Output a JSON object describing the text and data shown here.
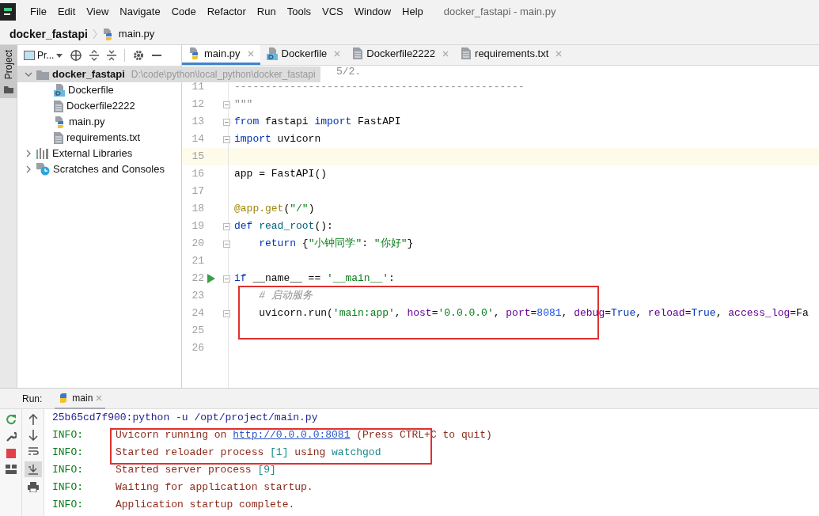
{
  "menu": [
    "File",
    "Edit",
    "View",
    "Navigate",
    "Code",
    "Refactor",
    "Run",
    "Tools",
    "VCS",
    "Window",
    "Help"
  ],
  "window_title": "docker_fastapi - main.py",
  "breadcrumb": [
    "docker_fastapi",
    "main.py"
  ],
  "tool_strip": {
    "label": "Project"
  },
  "project_panel": {
    "view_label": "Pr...",
    "tree": [
      {
        "label": "docker_fastapi",
        "path": "D:\\code\\python\\local_python\\docker_fastapi",
        "kind": "folder",
        "selected": true,
        "expanded": true,
        "children": [
          {
            "label": "Dockerfile",
            "kind": "docker",
            "selected": false
          },
          {
            "label": "Dockerfile2222",
            "kind": "text",
            "selected": false
          },
          {
            "label": "main.py",
            "kind": "python",
            "selected": false
          },
          {
            "label": "requirements.txt",
            "kind": "text",
            "selected": false
          }
        ]
      },
      {
        "label": "External Libraries",
        "kind": "library",
        "selected": false,
        "expanded": false
      },
      {
        "label": "Scratches and Consoles",
        "kind": "scratch",
        "selected": false,
        "expanded": false
      }
    ]
  },
  "editor_tabs": [
    {
      "label": "main.py",
      "kind": "python",
      "selected": true
    },
    {
      "label": "Dockerfile",
      "kind": "docker",
      "selected": false
    },
    {
      "label": "Dockerfile2222",
      "kind": "text",
      "selected": false
    },
    {
      "label": "requirements.txt",
      "kind": "text",
      "selected": false
    }
  ],
  "code_lines": [
    {
      "tokens": [
        {
          "kind": "doc",
          "text": "5/2."
        }
      ]
    },
    {
      "number": "11",
      "tokens": [
        {
          "kind": "doc",
          "text": "-----------------------------------------------"
        }
      ]
    },
    {
      "number": "12",
      "fold": true,
      "tokens": [
        {
          "kind": "doc",
          "text": "\"\"\""
        }
      ]
    },
    {
      "number": "13",
      "fold": true,
      "tokens": [
        {
          "kind": "kw",
          "text": "from"
        },
        {
          "kind": "plain",
          "text": " fastapi "
        },
        {
          "kind": "kw",
          "text": "import"
        },
        {
          "kind": "plain",
          "text": " FastAPI"
        }
      ]
    },
    {
      "number": "14",
      "fold": true,
      "tokens": [
        {
          "kind": "kw",
          "text": "import"
        },
        {
          "kind": "plain",
          "text": " uvicorn"
        }
      ]
    },
    {
      "number": "15",
      "current": true
    },
    {
      "number": "16",
      "tokens": [
        {
          "kind": "plain",
          "text": "app = FastAPI()"
        }
      ]
    },
    {
      "number": "17"
    },
    {
      "number": "18",
      "tokens": [
        {
          "kind": "deco",
          "text": "@app.get"
        },
        {
          "kind": "plain",
          "text": "("
        },
        {
          "kind": "str",
          "text": "\"/\""
        },
        {
          "kind": "plain",
          "text": ")"
        }
      ]
    },
    {
      "number": "19",
      "fold": true,
      "tokens": [
        {
          "kind": "kw",
          "text": "def"
        },
        {
          "kind": "fn",
          "text": " read_root"
        },
        {
          "kind": "plain",
          "text": "():"
        }
      ]
    },
    {
      "number": "20",
      "fold": true,
      "tokens": [
        {
          "kind": "kw",
          "text": "    return"
        },
        {
          "kind": "plain",
          "text": " {"
        },
        {
          "kind": "str",
          "text": "\"小钟同学\""
        },
        {
          "kind": "plain",
          "text": ": "
        },
        {
          "kind": "str",
          "text": "\"你好\""
        },
        {
          "kind": "plain",
          "text": "}"
        }
      ]
    },
    {
      "number": "21"
    },
    {
      "number": "22",
      "fold": true,
      "run": true,
      "tokens": [
        {
          "kind": "kw",
          "text": "if"
        },
        {
          "kind": "plain",
          "text": " __name__ == "
        },
        {
          "kind": "str",
          "text": "'__main__'"
        },
        {
          "kind": "plain",
          "text": ":"
        }
      ]
    },
    {
      "number": "23",
      "boxed": true,
      "tokens": [
        {
          "kind": "comment",
          "text": "    # 启动服务"
        }
      ]
    },
    {
      "number": "24",
      "boxed": true,
      "fold": true,
      "tokens": [
        {
          "kind": "plain",
          "text": "    uvicorn.run("
        },
        {
          "kind": "str",
          "text": "'main:app'"
        },
        {
          "kind": "plain",
          "text": ", "
        },
        {
          "kind": "param",
          "text": "host"
        },
        {
          "kind": "plain",
          "text": "="
        },
        {
          "kind": "str",
          "text": "'0.0.0.0'"
        },
        {
          "kind": "plain",
          "text": ", "
        },
        {
          "kind": "param",
          "text": "port"
        },
        {
          "kind": "plain",
          "text": "="
        },
        {
          "kind": "num",
          "text": "8081"
        },
        {
          "kind": "plain",
          "text": ", "
        },
        {
          "kind": "param",
          "text": "debug"
        },
        {
          "kind": "plain",
          "text": "="
        },
        {
          "kind": "kw",
          "text": "True"
        },
        {
          "kind": "plain",
          "text": ", "
        },
        {
          "kind": "param",
          "text": "reload"
        },
        {
          "kind": "plain",
          "text": "="
        },
        {
          "kind": "kw",
          "text": "True"
        },
        {
          "kind": "plain",
          "text": ", "
        },
        {
          "kind": "param",
          "text": "access_log"
        },
        {
          "kind": "plain",
          "text": "=Fa"
        }
      ]
    },
    {
      "number": "25",
      "boxed": true
    },
    {
      "number": "26"
    }
  ],
  "run_panel": {
    "label": "Run:",
    "tab": "main",
    "lines": [
      {
        "kind": "command",
        "parts": [
          {
            "kind": "cmd",
            "text": "25b65cd7f900:python -u /opt/project/main.py"
          }
        ]
      },
      {
        "kind": "log",
        "level": "INFO:",
        "boxed": true,
        "parts": [
          {
            "kind": "msg",
            "text": "Uvicorn running on "
          },
          {
            "kind": "link",
            "text": "http://0.0.0.0:8081"
          },
          {
            "kind": "msg",
            "text": " (Press CTRL+C to quit)"
          }
        ]
      },
      {
        "kind": "log",
        "level": "INFO:",
        "boxed": true,
        "parts": [
          {
            "kind": "msg",
            "text": "Started reloader process "
          },
          {
            "kind": "num",
            "text": "[1]"
          },
          {
            "kind": "msg",
            "text": " using "
          },
          {
            "kind": "num",
            "text": "watchgod"
          }
        ]
      },
      {
        "kind": "log",
        "level": "INFO:",
        "parts": [
          {
            "kind": "msg",
            "text": "Started server process "
          },
          {
            "kind": "num",
            "text": "[9]"
          }
        ]
      },
      {
        "kind": "log",
        "level": "INFO:",
        "parts": [
          {
            "kind": "msg",
            "text": "Waiting for application startup."
          }
        ]
      },
      {
        "kind": "log",
        "level": "INFO:",
        "parts": [
          {
            "kind": "msg",
            "text": "Application startup complete."
          }
        ]
      }
    ]
  }
}
